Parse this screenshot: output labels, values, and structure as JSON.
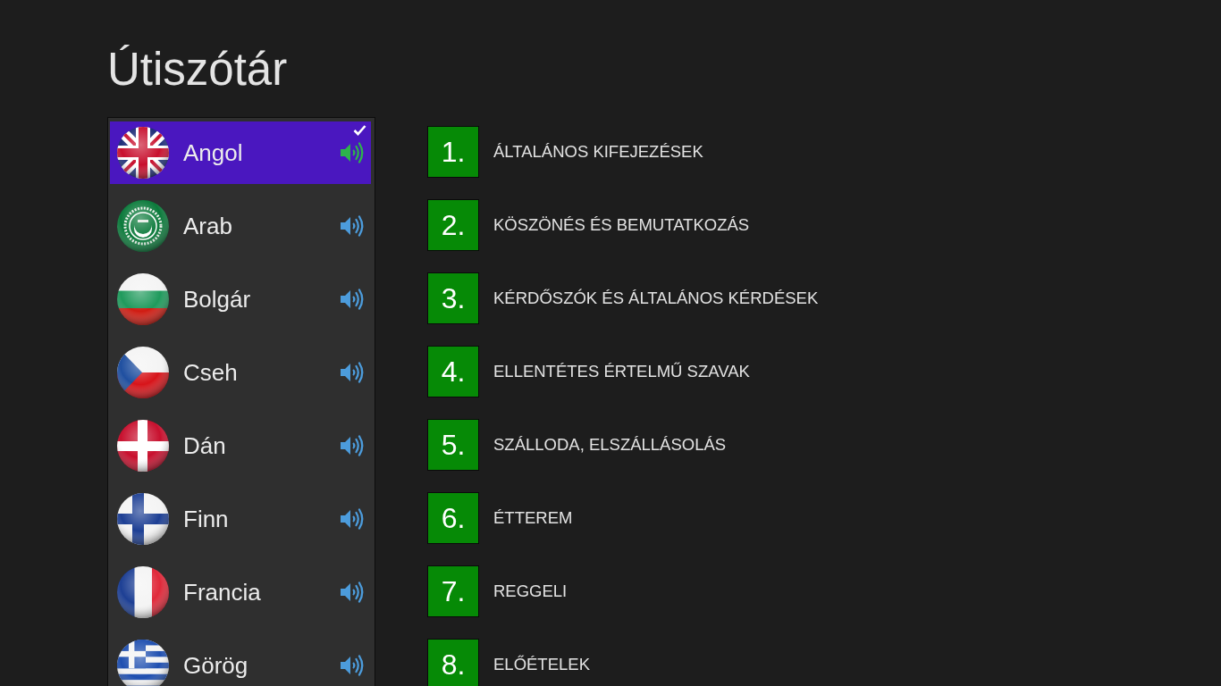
{
  "title": "Útiszótár",
  "languages": [
    {
      "name": "Angol",
      "selected": true
    },
    {
      "name": "Arab",
      "selected": false
    },
    {
      "name": "Bolgár",
      "selected": false
    },
    {
      "name": "Cseh",
      "selected": false
    },
    {
      "name": "Dán",
      "selected": false
    },
    {
      "name": "Finn",
      "selected": false
    },
    {
      "name": "Francia",
      "selected": false
    },
    {
      "name": "Görög",
      "selected": false
    }
  ],
  "topics": [
    {
      "number": "1.",
      "label": "ÁLTALÁNOS KIFEJEZÉSEK"
    },
    {
      "number": "2.",
      "label": "KÖSZÖNÉS ÉS BEMUTATKOZÁS"
    },
    {
      "number": "3.",
      "label": "KÉRDŐSZÓK ÉS ÁLTALÁNOS KÉRDÉSEK"
    },
    {
      "number": "4.",
      "label": "ELLENTÉTES ÉRTELMŰ SZAVAK"
    },
    {
      "number": "5.",
      "label": "SZÁLLODA, ELSZÁLLÁSOLÁS"
    },
    {
      "number": "6.",
      "label": "ÉTTEREM"
    },
    {
      "number": "7.",
      "label": "REGGELI"
    },
    {
      "number": "8.",
      "label": "ELŐÉTELEK"
    }
  ]
}
